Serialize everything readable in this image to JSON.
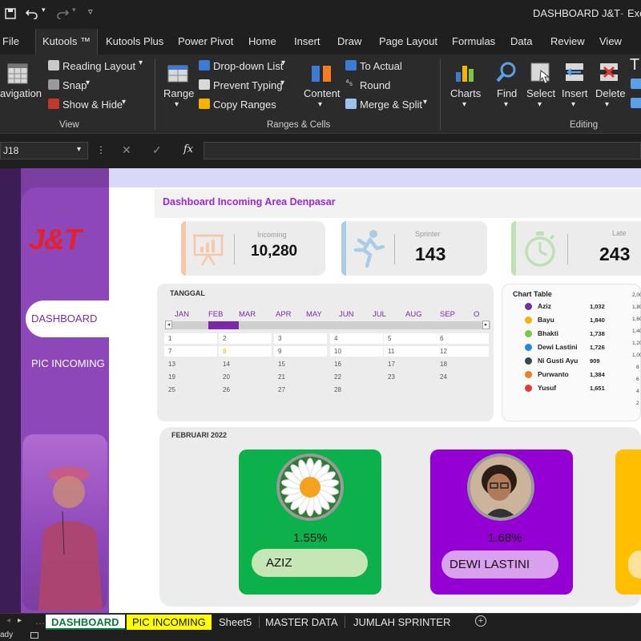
{
  "window": {
    "title": "DASHBOARD J&T",
    "title_suffix": "Exc"
  },
  "ribbon_tabs": [
    "File",
    "Kutools ™",
    "Kutools Plus",
    "Power Pivot",
    "Home",
    "Insert",
    "Draw",
    "Page Layout",
    "Formulas",
    "Data",
    "Review",
    "View"
  ],
  "ribbon": {
    "navigation": "avigation",
    "reading_layout": "Reading Layout",
    "snap": "Snap",
    "show_hide": "Show & Hide",
    "view_group": "View",
    "range": "Range",
    "dropdown_list": "Drop-down List",
    "prevent_typing": "Prevent Typing",
    "copy_ranges": "Copy Ranges",
    "content": "Content",
    "to_actual": "To Actual",
    "round": "Round",
    "merge_split": "Merge & Split",
    "ranges_cells_group": "Ranges & Cells",
    "charts": "Charts",
    "find": "Find",
    "select": "Select",
    "insert": "Insert",
    "delete": "Delete",
    "editing_group": "Editing"
  },
  "formula_bar": {
    "name_box": "J18",
    "fx": "fx",
    "value": ""
  },
  "sidebar": {
    "logo": "J&T",
    "nav": [
      {
        "label": "DASHBOARD",
        "active": true
      },
      {
        "label": "PIC INCOMING",
        "active": false
      }
    ]
  },
  "header": {
    "title": "Dashboard Incoming Area Denpasar"
  },
  "kpis": [
    {
      "label": "Incoming",
      "value": "10,280",
      "color": "#f6c7a8",
      "icon": "presentation-board-icon"
    },
    {
      "label": "Sprinter",
      "value": "143",
      "color": "#a9cde6",
      "icon": "running-person-icon"
    },
    {
      "label": "Late",
      "value": "243",
      "color": "#bfe0b4",
      "icon": "stopwatch-icon"
    }
  ],
  "calendar": {
    "title": "TANGGAL",
    "months": [
      "JAN",
      "FEB",
      "MAR",
      "APR",
      "MAY",
      "JUN",
      "JUL",
      "AUG",
      "SEP",
      "O"
    ],
    "selected_month": "FEB",
    "rows": [
      [
        "1",
        "2",
        "3",
        "4",
        "5",
        "6"
      ],
      [
        "7",
        "8",
        "9",
        "10",
        "11",
        "12"
      ],
      [
        "13",
        "14",
        "15",
        "16",
        "17",
        "18"
      ],
      [
        "19",
        "20",
        "21",
        "22",
        "23",
        "24"
      ],
      [
        "25",
        "26",
        "27",
        "28",
        "",
        ""
      ]
    ],
    "highlight_day": "8"
  },
  "chart_table": {
    "title": "Chart Table",
    "rows": [
      {
        "name": "Aziz",
        "value": "1,032",
        "color": "#7a2aa8"
      },
      {
        "name": "Bayu",
        "value": "1,840",
        "color": "#f4b400"
      },
      {
        "name": "Bhakti",
        "value": "1,738",
        "color": "#7ac943"
      },
      {
        "name": "Dewi Lastini",
        "value": "1,726",
        "color": "#1e88e5"
      },
      {
        "name": "Ni Gusti Ayu",
        "value": "909",
        "color": "#37474f"
      },
      {
        "name": "Purwanto",
        "value": "1,384",
        "color": "#f57c1f"
      },
      {
        "name": "Yusuf",
        "value": "1,651",
        "color": "#e53935"
      }
    ],
    "axis_ticks": [
      "2,00",
      "1,80",
      "1,60",
      "1,40",
      "1,20",
      "1,00",
      "8",
      "6",
      "4",
      "2"
    ]
  },
  "bottom_panel": {
    "title": "FEBRUARI 2022",
    "cards": [
      {
        "percent": "1.55%",
        "name": "AZIZ",
        "color": "#0db14b",
        "pill": "#c6e6b6",
        "avatar": "daisy-flower-avatar"
      },
      {
        "percent": "1.68%",
        "name": "DEWI LASTINI",
        "color": "#9400d3",
        "pill": "#d9a0ee",
        "avatar": "person-photo-avatar"
      },
      {
        "percent": "",
        "name": "",
        "color": "#ffbf00",
        "pill": "#ffe29a",
        "avatar": ""
      }
    ]
  },
  "sheet_tabs": [
    {
      "label": "DASHBOARD",
      "bg": "#ffffff",
      "fg": "#0a7a3a",
      "active": true
    },
    {
      "label": "PIC INCOMING",
      "bg": "#ffff00",
      "fg": "#111111",
      "active": false
    },
    {
      "label": "Sheet5",
      "bg": "",
      "fg": "#e6e6e6",
      "active": false
    },
    {
      "label": "MASTER DATA",
      "bg": "",
      "fg": "#e6e6e6",
      "active": false
    },
    {
      "label": "JUMLAH SPRINTER",
      "bg": "",
      "fg": "#e6e6e6",
      "active": false
    }
  ],
  "status": {
    "text": "ady"
  }
}
